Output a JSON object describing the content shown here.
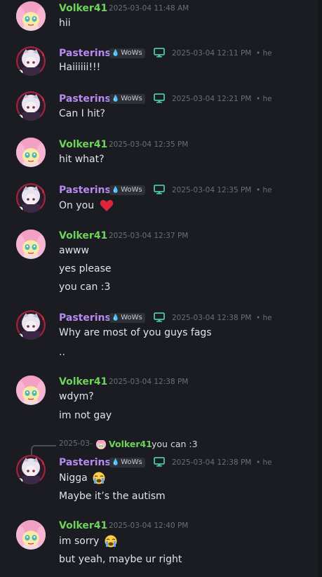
{
  "users": {
    "volker": {
      "name": "Volker41"
    },
    "pasterins": {
      "name": "Pasterins",
      "tag": "WoWs",
      "tag_icon": "water-drop-icon",
      "platform_icon": "desktop-icon"
    }
  },
  "colors": {
    "volker": "#6ed35a",
    "pasterins": "#b78af0",
    "background": "#1b1c21",
    "timestamp": "#6b6e78",
    "text": "#e1e3e8"
  },
  "messages": [
    {
      "author": "Volker41",
      "timestamp": "2025-03-04 11:48 AM",
      "suffix": "",
      "lines": [
        "hii"
      ]
    },
    {
      "author": "Pasterins",
      "timestamp": "2025-03-04 12:11 PM",
      "suffix": "• he",
      "lines": [
        "Haiiiiii!!!"
      ]
    },
    {
      "author": "Pasterins",
      "timestamp": "2025-03-04 12:21 PM",
      "suffix": "• he",
      "lines": [
        "Can I hit?"
      ]
    },
    {
      "author": "Volker41",
      "timestamp": "2025-03-04 12:35 PM",
      "suffix": "",
      "lines": [
        "hit what?"
      ]
    },
    {
      "author": "Pasterins",
      "timestamp": "2025-03-04 12:35 PM",
      "suffix": "• he",
      "lines": [
        "On you"
      ],
      "emoji": "red-heart"
    },
    {
      "author": "Volker41",
      "timestamp": "2025-03-04 12:37 PM",
      "suffix": "",
      "lines": [
        "awww",
        "yes please",
        "you can :3"
      ]
    },
    {
      "author": "Pasterins",
      "timestamp": "2025-03-04 12:38 PM",
      "suffix": "• he",
      "lines": [
        "Why are most of you guys fags",
        ".."
      ]
    },
    {
      "author": "Volker41",
      "timestamp": "2025-03-04 12:38 PM",
      "suffix": "",
      "lines": [
        "wdym?",
        "im not gay"
      ]
    },
    {
      "author": "Pasterins",
      "timestamp": "2025-03-04 12:38 PM",
      "suffix": "• he",
      "lines": [
        "Nigga",
        "Maybe it’s the autism"
      ],
      "emoji": "loudly-crying-face",
      "reply": {
        "timestamp": "2025-03-",
        "author": "Volker41",
        "text": "you can :3"
      }
    },
    {
      "author": "Volker41",
      "timestamp": "2025-03-04 12:40 PM",
      "suffix": "",
      "lines": [
        "im sorry",
        "but yeah, maybe ur right"
      ],
      "emoji": "loudly-crying-face"
    }
  ]
}
